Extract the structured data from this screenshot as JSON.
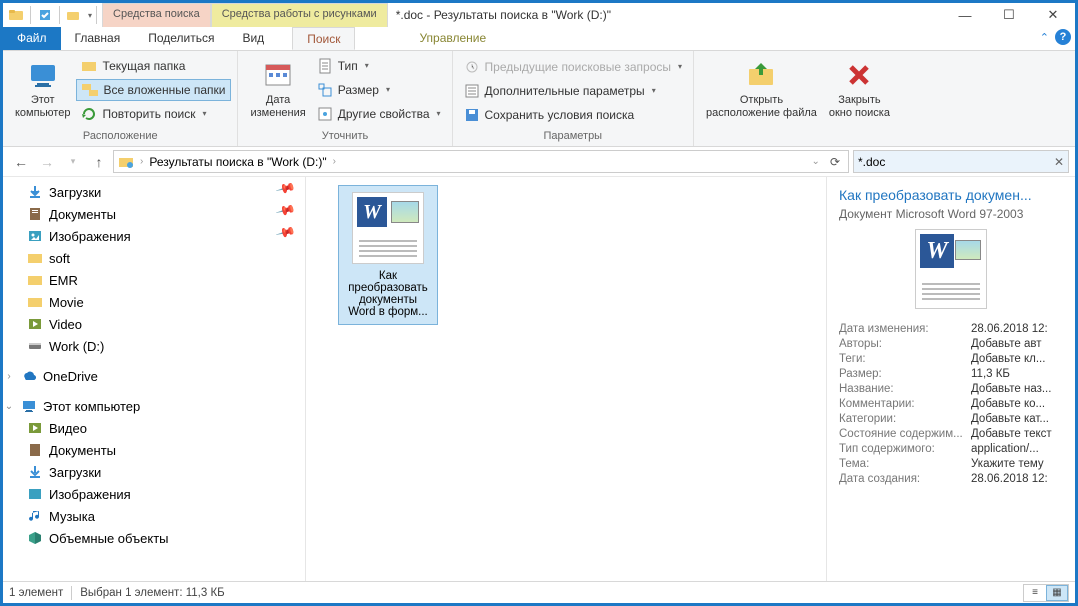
{
  "title": "*.doc - Результаты поиска в \"Work (D:)\"",
  "tool_tabs": {
    "search": "Средства поиска",
    "picture": "Средства работы с рисунками"
  },
  "tabs": {
    "file": "Файл",
    "home": "Главная",
    "share": "Поделиться",
    "view": "Вид",
    "search": "Поиск",
    "manage": "Управление"
  },
  "ribbon": {
    "loc": {
      "this_pc": "Этот\nкомпьютер",
      "current": "Текущая папка",
      "all_sub": "Все вложенные папки",
      "repeat": "Повторить поиск",
      "label": "Расположение"
    },
    "refine": {
      "date": "Дата\nизменения",
      "type": "Тип",
      "size": "Размер",
      "other": "Другие свойства",
      "label": "Уточнить"
    },
    "params": {
      "recent": "Предыдущие поисковые запросы",
      "adv": "Дополнительные параметры",
      "save": "Сохранить условия поиска",
      "label": "Параметры"
    },
    "open_loc": "Открыть\nрасположение файла",
    "close": "Закрыть\nокно поиска"
  },
  "breadcrumb": "Результаты поиска в \"Work (D:)\"",
  "search_value": "*.doc",
  "tree": {
    "downloads": "Загрузки",
    "documents": "Документы",
    "images": "Изображения",
    "soft": "soft",
    "emr": "EMR",
    "movie": "Movie",
    "video": "Video",
    "workd": "Work (D:)",
    "onedrive": "OneDrive",
    "thispc": "Этот компьютер",
    "pc_video": "Видео",
    "pc_docs": "Документы",
    "pc_dl": "Загрузки",
    "pc_img": "Изображения",
    "pc_music": "Музыка",
    "pc_3d": "Объемные объекты"
  },
  "file": {
    "name": "Как преобразовать документы Word в форм..."
  },
  "details": {
    "title": "Как преобразовать докумен...",
    "subtitle": "Документ Microsoft Word 97-2003",
    "rows": [
      {
        "l": "Дата изменения:",
        "v": "28.06.2018 12:"
      },
      {
        "l": "Авторы:",
        "v": "Добавьте авт"
      },
      {
        "l": "Теги:",
        "v": "Добавьте кл..."
      },
      {
        "l": "Размер:",
        "v": "11,3 КБ"
      },
      {
        "l": "Название:",
        "v": "Добавьте наз..."
      },
      {
        "l": "Комментарии:",
        "v": "Добавьте ко..."
      },
      {
        "l": "Категории:",
        "v": "Добавьте кат..."
      },
      {
        "l": "Состояние содержим...",
        "v": "Добавьте текст"
      },
      {
        "l": "Тип содержимого:",
        "v": "application/..."
      },
      {
        "l": "Тема:",
        "v": "Укажите тему"
      },
      {
        "l": "Дата создания:",
        "v": "28.06.2018 12:"
      }
    ]
  },
  "status": {
    "count": "1 элемент",
    "sel": "Выбран 1 элемент: 11,3 КБ"
  }
}
